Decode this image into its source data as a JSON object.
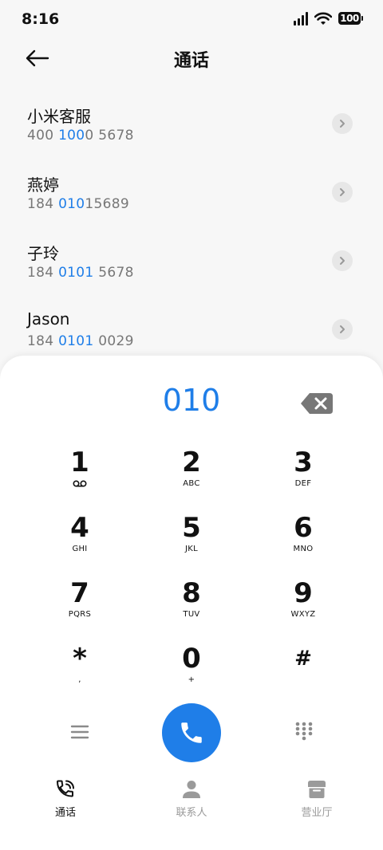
{
  "status_bar": {
    "time": "8:16",
    "battery": "100"
  },
  "header": {
    "title": "通话"
  },
  "contacts": [
    {
      "name": "小米客服",
      "number_parts": [
        "400 ",
        "100",
        "0 5678"
      ]
    },
    {
      "name": "燕婷",
      "number_parts": [
        "184 ",
        "010",
        "15689"
      ]
    },
    {
      "name": "子玲",
      "number_parts": [
        "184 ",
        "0101",
        " 5678"
      ]
    },
    {
      "name": "Jason",
      "number_parts": [
        "184 ",
        "0101",
        " 0029"
      ]
    }
  ],
  "dialer": {
    "input": "010",
    "keys": [
      {
        "digit": "1",
        "letters": ""
      },
      {
        "digit": "2",
        "letters": "ABC"
      },
      {
        "digit": "3",
        "letters": "DEF"
      },
      {
        "digit": "4",
        "letters": "GHI"
      },
      {
        "digit": "5",
        "letters": "JKL"
      },
      {
        "digit": "6",
        "letters": "MNO"
      },
      {
        "digit": "7",
        "letters": "PQRS"
      },
      {
        "digit": "8",
        "letters": "TUV"
      },
      {
        "digit": "9",
        "letters": "WXYZ"
      },
      {
        "digit": "*",
        "letters": ","
      },
      {
        "digit": "0",
        "letters": "+"
      },
      {
        "digit": "#",
        "letters": ""
      }
    ]
  },
  "bottom_nav": [
    {
      "label": "通话",
      "icon": "phone-calls-icon",
      "active": true
    },
    {
      "label": "联系人",
      "icon": "person-icon",
      "active": false
    },
    {
      "label": "营业厅",
      "icon": "store-icon",
      "active": false
    }
  ],
  "colors": {
    "accent": "#1f7ee8",
    "inactive": "#9a9a9a"
  }
}
